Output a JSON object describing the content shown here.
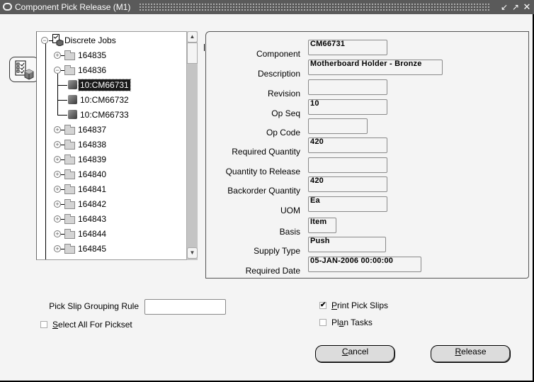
{
  "window": {
    "title": "Component Pick Release (M1)",
    "controls": {
      "minimize": "minimize",
      "maximize": "maximize",
      "close": "close"
    }
  },
  "tree": {
    "root": {
      "label": "Discrete Jobs",
      "expanded": true,
      "icon": "discrete-jobs-icon"
    },
    "nodes": [
      {
        "label": "164835",
        "expanded": false,
        "icon": "folder-icon"
      },
      {
        "label": "164836",
        "expanded": true,
        "icon": "folder-icon",
        "children": [
          {
            "label": "10:CM66731",
            "icon": "component-icon",
            "selected": true
          },
          {
            "label": "10:CM66732",
            "icon": "component-icon",
            "selected": false
          },
          {
            "label": "10:CM66733",
            "icon": "component-icon",
            "selected": false
          }
        ]
      },
      {
        "label": "164837",
        "expanded": false,
        "icon": "folder-icon"
      },
      {
        "label": "164838",
        "expanded": false,
        "icon": "folder-icon"
      },
      {
        "label": "164839",
        "expanded": false,
        "icon": "folder-icon"
      },
      {
        "label": "164840",
        "expanded": false,
        "icon": "folder-icon"
      },
      {
        "label": "164841",
        "expanded": false,
        "icon": "folder-icon"
      },
      {
        "label": "164842",
        "expanded": false,
        "icon": "folder-icon"
      },
      {
        "label": "164843",
        "expanded": false,
        "icon": "folder-icon"
      },
      {
        "label": "164844",
        "expanded": false,
        "icon": "folder-icon"
      },
      {
        "label": "164845",
        "expanded": false,
        "icon": "folder-icon"
      }
    ]
  },
  "details": {
    "fields": [
      {
        "label": "Component",
        "value": "CM66731"
      },
      {
        "label": "Description",
        "value": "Motherboard Holder - Bronze"
      },
      {
        "label": "Revision",
        "value": ""
      },
      {
        "label": "Op Seq",
        "value": "10"
      },
      {
        "label": "Op Code",
        "value": ""
      },
      {
        "label": "Required Quantity",
        "value": "420"
      },
      {
        "label": "Quantity to Release",
        "value": ""
      },
      {
        "label": "Backorder Quantity",
        "value": "420"
      },
      {
        "label": "UOM",
        "value": "Ea"
      },
      {
        "label": "Basis",
        "value": "Item"
      },
      {
        "label": "Supply Type",
        "value": "Push"
      },
      {
        "label": "Required Date",
        "value": "05-JAN-2006 00:00:00"
      }
    ]
  },
  "options": {
    "pick_slip_grouping_rule": {
      "label": "Pick Slip Grouping Rule",
      "value": ""
    },
    "select_all_for_pickset": {
      "label_underlined": "S",
      "label_rest": "elect All For Pickset",
      "checked": false
    },
    "print_pick_slips": {
      "label_underlined": "P",
      "label_rest": "rint Pick Slips",
      "checked": true
    },
    "plan_tasks": {
      "label_pre": "Pl",
      "label_underlined": "a",
      "label_rest": "n Tasks",
      "checked": false
    }
  },
  "buttons": {
    "cancel": {
      "underlined": "C",
      "rest": "ancel"
    },
    "release": {
      "underlined": "R",
      "rest": "elease"
    }
  },
  "check_glyph": "✔"
}
